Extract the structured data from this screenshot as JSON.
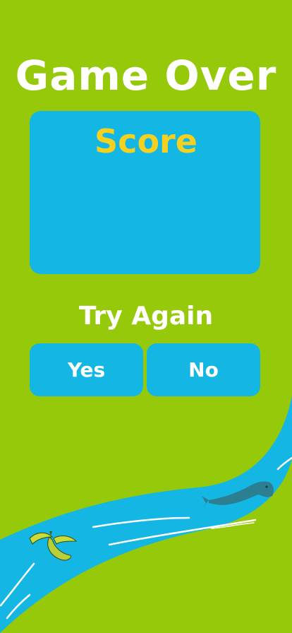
{
  "game": {
    "title": "Game Over",
    "score_label": "Score",
    "score_value": "",
    "prompt": "Try Again",
    "yes_label": "Yes",
    "no_label": "No"
  },
  "colors": {
    "background": "#95c90a",
    "panel": "#14b7e3",
    "score_text": "#f4d020",
    "text": "#ffffff",
    "river": "#14b7e3"
  },
  "decor": {
    "items": [
      "banana-peel-icon",
      "swimming-fish-icon",
      "river-ripple-lines"
    ]
  }
}
